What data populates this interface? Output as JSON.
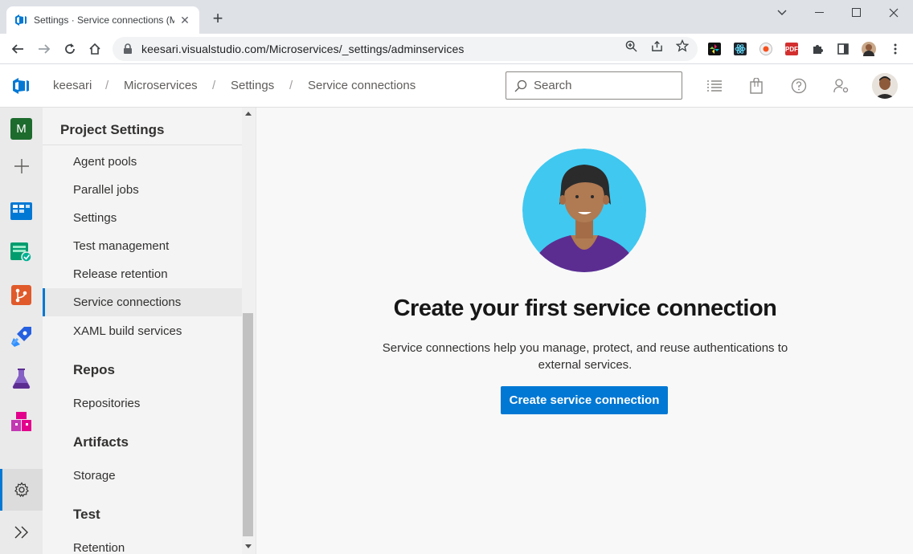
{
  "browser": {
    "tab_title": "Settings · Service connections (M",
    "url": "keesari.visualstudio.com/Microservices/_settings/adminservices",
    "extensions": [
      "pinwheel-icon",
      "react-icon",
      "record-icon",
      "pdf-icon",
      "puzzle-icon",
      "sidepanel-icon",
      "profile-avatar",
      "menu-icon"
    ],
    "ext_pdf_label": "PDF"
  },
  "header": {
    "breadcrumb": {
      "org": "keesari",
      "project": "Microservices",
      "section": "Settings",
      "page": "Service connections",
      "separator": "/"
    },
    "search_placeholder": "Search"
  },
  "rail": {
    "project_initial": "M",
    "items": [
      "project-avatar",
      "add-icon",
      "boards-icon",
      "test-plans-icon",
      "repos-icon",
      "pipelines-icon",
      "test-icon",
      "artifacts-icon"
    ]
  },
  "nav": {
    "title": "Project Settings",
    "pipelines_items": [
      "Agent pools",
      "Parallel jobs",
      "Settings",
      "Test management",
      "Release retention",
      "Service connections",
      "XAML build services"
    ],
    "selected": "Service connections",
    "sections": {
      "repos": {
        "title": "Repos",
        "items": [
          "Repositories"
        ]
      },
      "artifacts": {
        "title": "Artifacts",
        "items": [
          "Storage"
        ]
      },
      "test": {
        "title": "Test",
        "items": [
          "Retention"
        ]
      }
    }
  },
  "main": {
    "title": "Create your first service connection",
    "description": "Service connections help you manage, protect, and reuse authentications to external services.",
    "button_label": "Create service connection"
  },
  "colors": {
    "accent": "#0078d4",
    "hero_bg": "#40c8f0",
    "shirt": "#5c2d91"
  }
}
